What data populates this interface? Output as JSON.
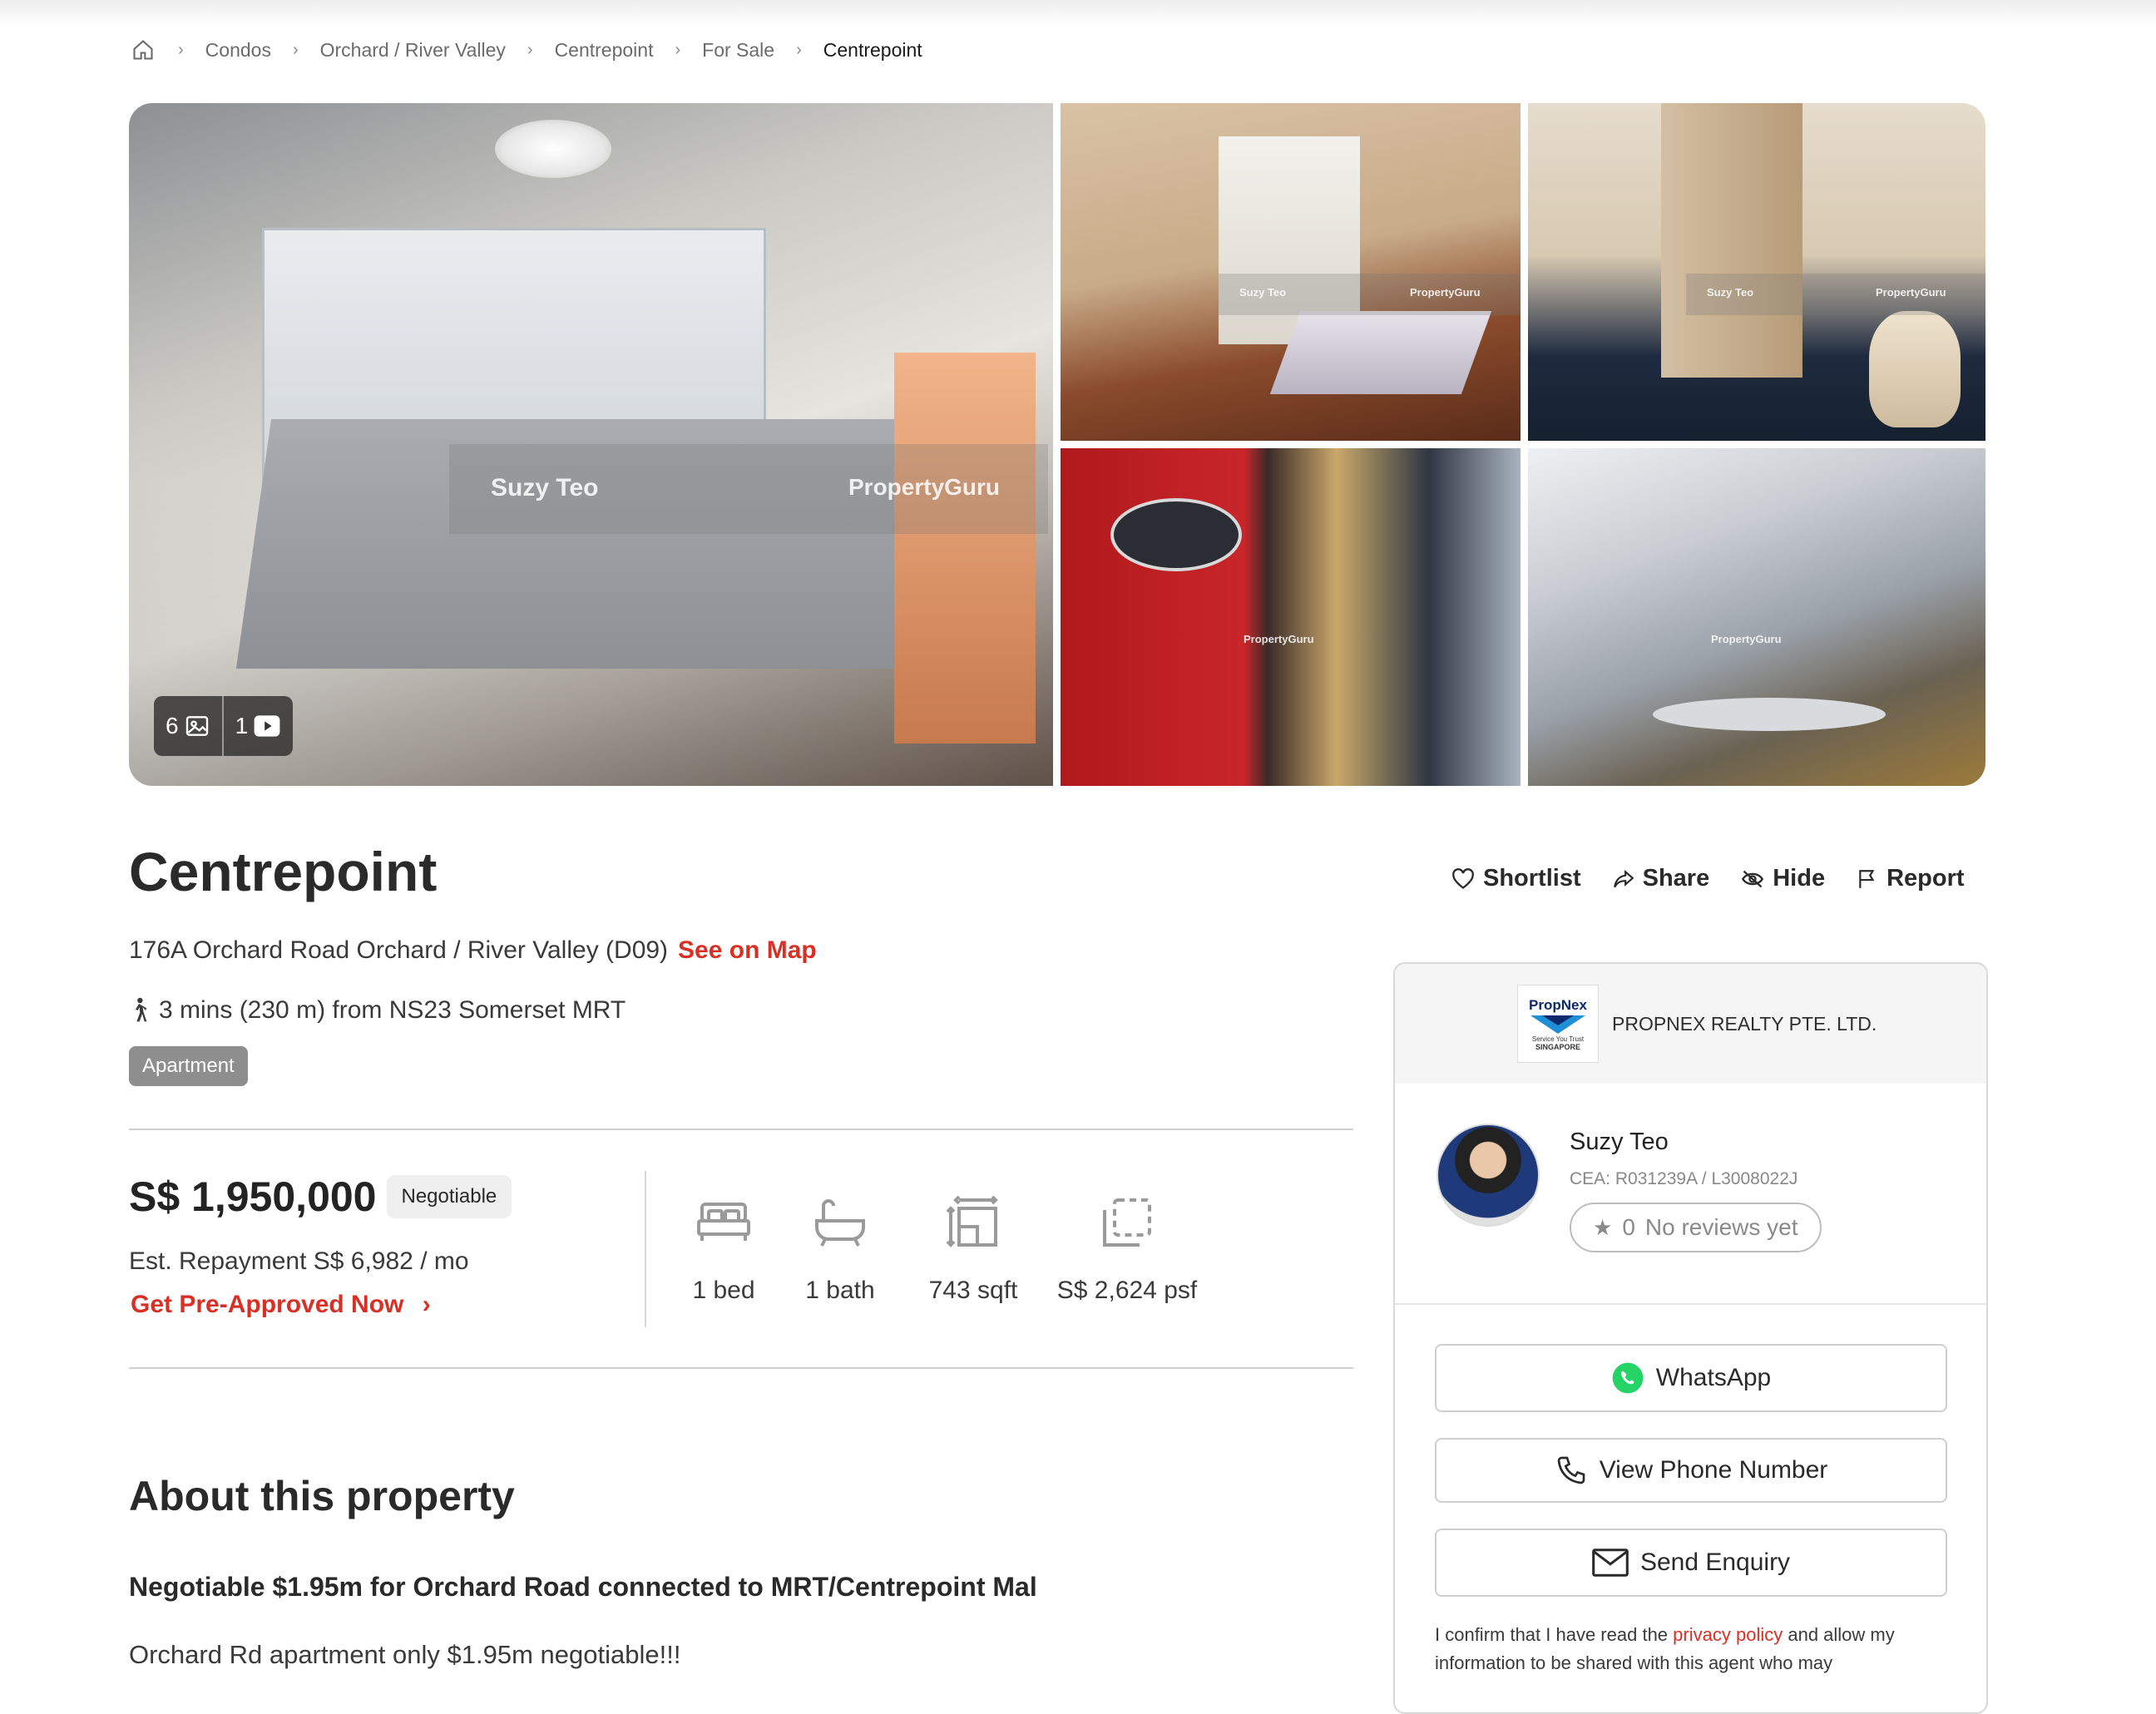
{
  "breadcrumb": {
    "home_icon": "home-icon",
    "items": [
      "Condos",
      "Orchard / River Valley",
      "Centrepoint",
      "For Sale"
    ],
    "current": "Centrepoint"
  },
  "gallery": {
    "watermark_agent": "Suzy Teo",
    "watermark_brand": "PropertyGuru",
    "photo_count": "6",
    "video_count": "1"
  },
  "listing": {
    "title": "Centrepoint",
    "address": "176A Orchard Road Orchard / River Valley (D09)",
    "see_on_map": "See on Map",
    "mrt": "3 mins (230 m) from NS23 Somerset MRT",
    "property_type": "Apartment",
    "price": "S$ 1,950,000",
    "negotiable": "Negotiable",
    "repayment": "Est. Repayment S$ 6,982 / mo",
    "pre_approved": "Get Pre-Approved Now",
    "specs": {
      "beds": "1 bed",
      "baths": "1 bath",
      "area": "743 sqft",
      "psf": "S$ 2,624 psf"
    }
  },
  "actions": {
    "shortlist": "Shortlist",
    "share": "Share",
    "hide": "Hide",
    "report": "Report"
  },
  "about": {
    "heading": "About this property",
    "headline": "Negotiable $1.95m for Orchard Road connected to MRT/Centrepoint Mal",
    "description": "Orchard Rd apartment only $1.95m negotiable!!!"
  },
  "agent_card": {
    "agency_logo_text": "PropNex",
    "agency_logo_tagline": "Service You Trust",
    "agency_logo_country": "SINGAPORE",
    "agency_name": "PROPNEX REALTY PTE. LTD.",
    "agent_name": "Suzy Teo",
    "cea": "CEA: R031239A / L3008022J",
    "review_count": "0",
    "reviews_text": "No reviews yet",
    "whatsapp": "WhatsApp",
    "view_phone": "View Phone Number",
    "send_enquiry": "Send Enquiry",
    "consent_prefix": "I confirm that I have read the",
    "consent_link": "privacy policy",
    "consent_suffix": "and allow my information to be shared with this agent who may"
  },
  "colors": {
    "accent_red": "#d93025",
    "whatsapp_green": "#25d366",
    "badge_gray": "#8e8e8e"
  }
}
